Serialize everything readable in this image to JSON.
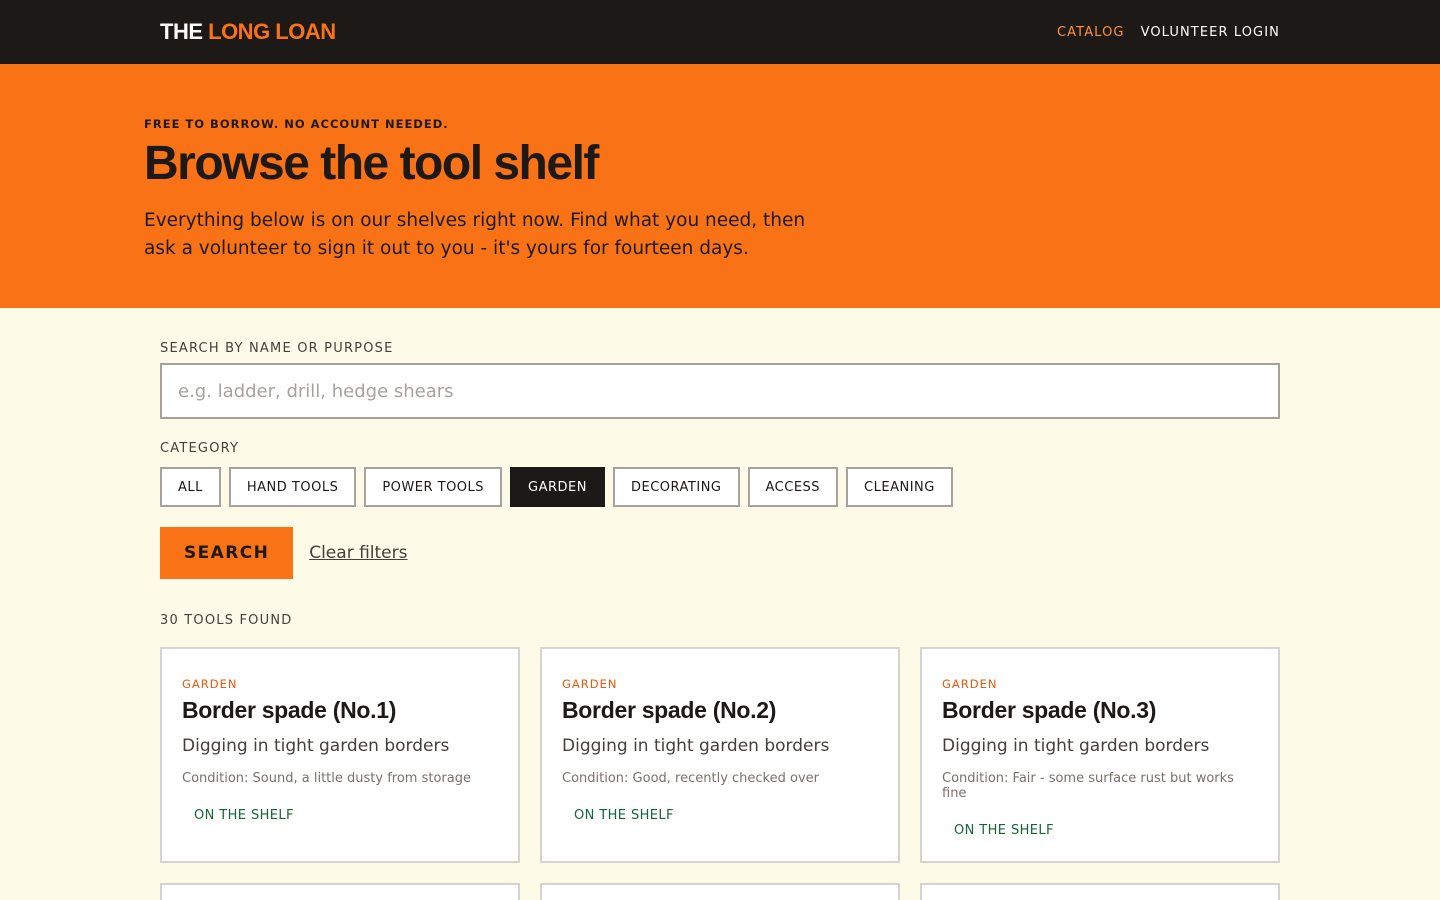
{
  "header": {
    "brand_primary": "THE",
    "brand_accent": "LONG LOAN",
    "nav": [
      {
        "label": "CATALOG",
        "active": true
      },
      {
        "label": "VOLUNTEER LOGIN",
        "active": false
      }
    ]
  },
  "hero": {
    "eyebrow": "FREE TO BORROW. NO ACCOUNT NEEDED.",
    "title": "Browse the tool shelf",
    "description": "Everything below is on our shelves right now. Find what you need, then ask a volunteer to sign it out to you - it's yours for fourteen days."
  },
  "search": {
    "label": "SEARCH BY NAME OR PURPOSE",
    "placeholder": "e.g. ladder, drill, hedge shears",
    "value": ""
  },
  "category": {
    "label": "CATEGORY",
    "chips": [
      "ALL",
      "HAND TOOLS",
      "POWER TOOLS",
      "GARDEN",
      "DECORATING",
      "ACCESS",
      "CLEANING"
    ],
    "selected": "GARDEN"
  },
  "actions": {
    "search_label": "SEARCH",
    "clear_label": "Clear filters"
  },
  "results": {
    "count_label": "30 TOOLS FOUND",
    "items": [
      {
        "category": "GARDEN",
        "title": "Border spade (No.1)",
        "purpose": "Digging in tight garden borders",
        "condition": "Condition: Sound, a little dusty from storage",
        "status": "ON THE SHELF"
      },
      {
        "category": "GARDEN",
        "title": "Border spade (No.2)",
        "purpose": "Digging in tight garden borders",
        "condition": "Condition: Good, recently checked over",
        "status": "ON THE SHELF"
      },
      {
        "category": "GARDEN",
        "title": "Border spade (No.3)",
        "purpose": "Digging in tight garden borders",
        "condition": "Condition: Fair - some surface rust but works fine",
        "status": "ON THE SHELF"
      }
    ]
  },
  "colors": {
    "topbar": "#1c1917",
    "accent": "#f97316",
    "page_bg": "#fefae8",
    "status_green": "#166534"
  }
}
